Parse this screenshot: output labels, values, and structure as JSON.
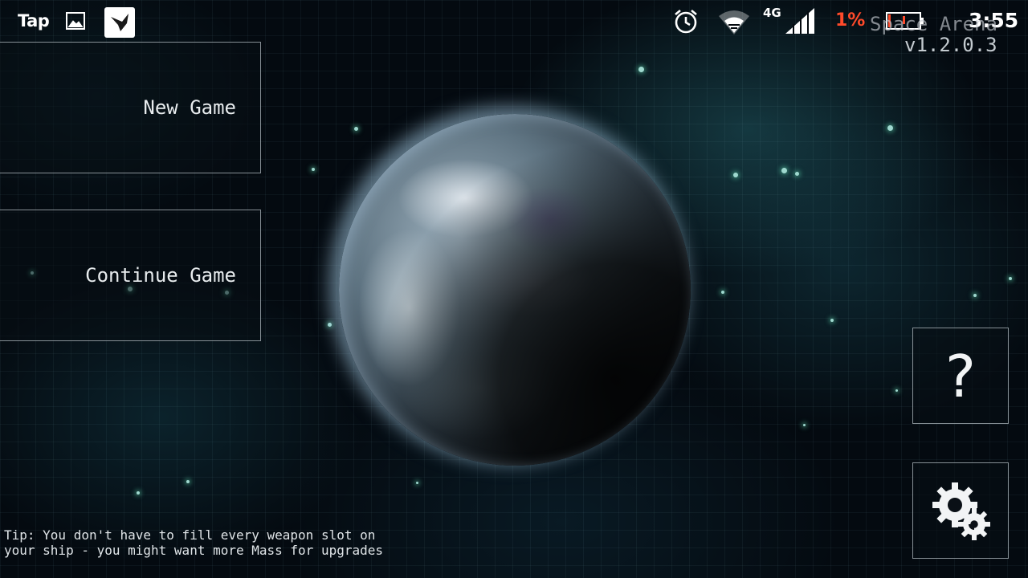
{
  "status_bar": {
    "app_label": "Tap",
    "network_type": "4G",
    "battery_percent": "1%",
    "time": "3:55",
    "icons": [
      "gallery-icon",
      "bird-app-icon",
      "alarm-icon",
      "wifi-icon",
      "signal-icon",
      "battery-icon"
    ],
    "battery_color": "#ff4a2a"
  },
  "header": {
    "title": "Space Arena",
    "version": "v1.2.0.3"
  },
  "menu": {
    "new_game_label": "New Game",
    "continue_game_label": "Continue Game"
  },
  "side_buttons": {
    "help_label": "?",
    "settings_icon": "gear-icon"
  },
  "tip": {
    "line1": "Tip: You don't have to fill every weapon slot on",
    "line2": "your ship - you might want more Mass for upgrades"
  }
}
